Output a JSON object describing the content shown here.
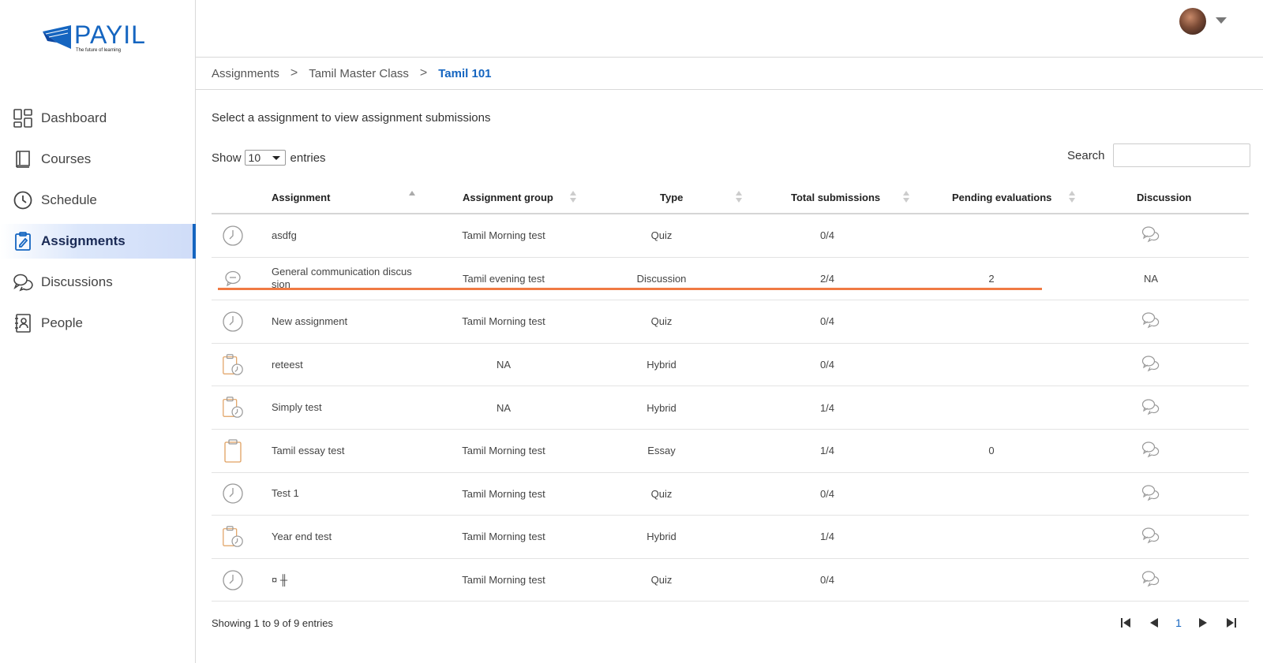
{
  "brand": {
    "name": "PAYIL",
    "tagline": "The future of learning",
    "color": "#1565c0"
  },
  "sidebar": {
    "items": [
      {
        "label": "Dashboard",
        "icon": "dashboard-icon"
      },
      {
        "label": "Courses",
        "icon": "book-icon"
      },
      {
        "label": "Schedule",
        "icon": "clock-icon"
      },
      {
        "label": "Assignments",
        "icon": "assignment-icon",
        "active": true
      },
      {
        "label": "Discussions",
        "icon": "chat-icon"
      },
      {
        "label": "People",
        "icon": "contact-book-icon"
      }
    ]
  },
  "breadcrumb": {
    "items": [
      "Assignments",
      "Tamil Master Class",
      "Tamil 101"
    ],
    "separator": ">"
  },
  "content": {
    "subtitle": "Select a assignment to view assignment submissions",
    "show_label": "Show",
    "entries_label": "entries",
    "page_size": "10",
    "search_label": "Search",
    "search_value": ""
  },
  "table": {
    "headers": [
      "Assignment",
      "Assignment group",
      "Type",
      "Total submissions",
      "Pending evaluations",
      "Discussion"
    ],
    "rows": [
      {
        "icon": "quiz-clock-icon",
        "name": "asdfg",
        "group": "Tamil Morning test",
        "type": "Quiz",
        "total": "0/4",
        "pending": "",
        "discussion": "chat-icon"
      },
      {
        "icon": "discussion-bubble-icon",
        "name": "General communication discus\nsion",
        "group": "Tamil evening test",
        "type": "Discussion",
        "total": "2/4",
        "pending": "2",
        "discussion": "NA"
      },
      {
        "icon": "quiz-clock-icon",
        "name": "New assignment",
        "group": "Tamil Morning test",
        "type": "Quiz",
        "total": "0/4",
        "pending": "",
        "discussion": "chat-icon"
      },
      {
        "icon": "hybrid-clipboard-clock-icon",
        "name": "reteest",
        "group": "NA",
        "type": "Hybrid",
        "total": "0/4",
        "pending": "",
        "discussion": "chat-icon"
      },
      {
        "icon": "hybrid-clipboard-clock-icon",
        "name": "Simply test",
        "group": "NA",
        "type": "Hybrid",
        "total": "1/4",
        "pending": "",
        "discussion": "chat-icon"
      },
      {
        "icon": "essay-clipboard-icon",
        "name": "Tamil essay test",
        "group": "Tamil Morning test",
        "type": "Essay",
        "total": "1/4",
        "pending": "0",
        "discussion": "chat-icon"
      },
      {
        "icon": "quiz-clock-icon",
        "name": "Test 1",
        "group": "Tamil Morning test",
        "type": "Quiz",
        "total": "0/4",
        "pending": "",
        "discussion": "chat-icon"
      },
      {
        "icon": "hybrid-clipboard-clock-icon",
        "name": "Year end test",
        "group": "Tamil Morning test",
        "type": "Hybrid",
        "total": "1/4",
        "pending": "",
        "discussion": "chat-icon"
      },
      {
        "icon": "quiz-clock-icon",
        "name": "¤ ╫",
        "group": "Tamil Morning test",
        "type": "Quiz",
        "total": "0/4",
        "pending": "",
        "discussion": "chat-icon"
      }
    ]
  },
  "footer": {
    "showing": "Showing 1 to 9 of 9 entries",
    "current_page": "1"
  },
  "colors": {
    "accent": "#1565c0",
    "highlight": "#f07a43",
    "active_bg": "#cfdcf8"
  }
}
